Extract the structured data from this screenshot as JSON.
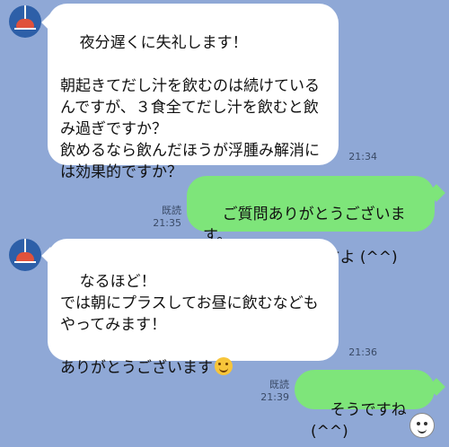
{
  "messages": [
    {
      "direction": "incoming",
      "text": "夜分遅くに失礼します！\n\n朝起きてだし汁を飲むのは続けているんですが、３食全てだし汁を飲むと飲み過ぎですか？\n飲めるなら飲んだほうが浮腫み解消には効果的ですか？",
      "time": "21:34"
    },
    {
      "direction": "outgoing",
      "text": "ご質問ありがとうございます。\n飲み過ぎは無いですよ (^^)",
      "read": "既読",
      "time": "21:35"
    },
    {
      "direction": "incoming",
      "text": "なるほど！\nでは朝にプラスしてお昼に飲むなどもやってみます！\n\nありがとうございます",
      "emoji": "smiling-face",
      "time": "21:36"
    },
    {
      "direction": "outgoing",
      "text": "そうですね (^^)",
      "read": "既読",
      "time": "21:39"
    }
  ],
  "colors": {
    "background": "#8fa8d6",
    "incoming_bubble": "#ffffff",
    "outgoing_bubble": "#7ee57a"
  },
  "icons": {
    "avatar": "lamp-avatar-icon",
    "sticker": "face-sticker-icon"
  }
}
